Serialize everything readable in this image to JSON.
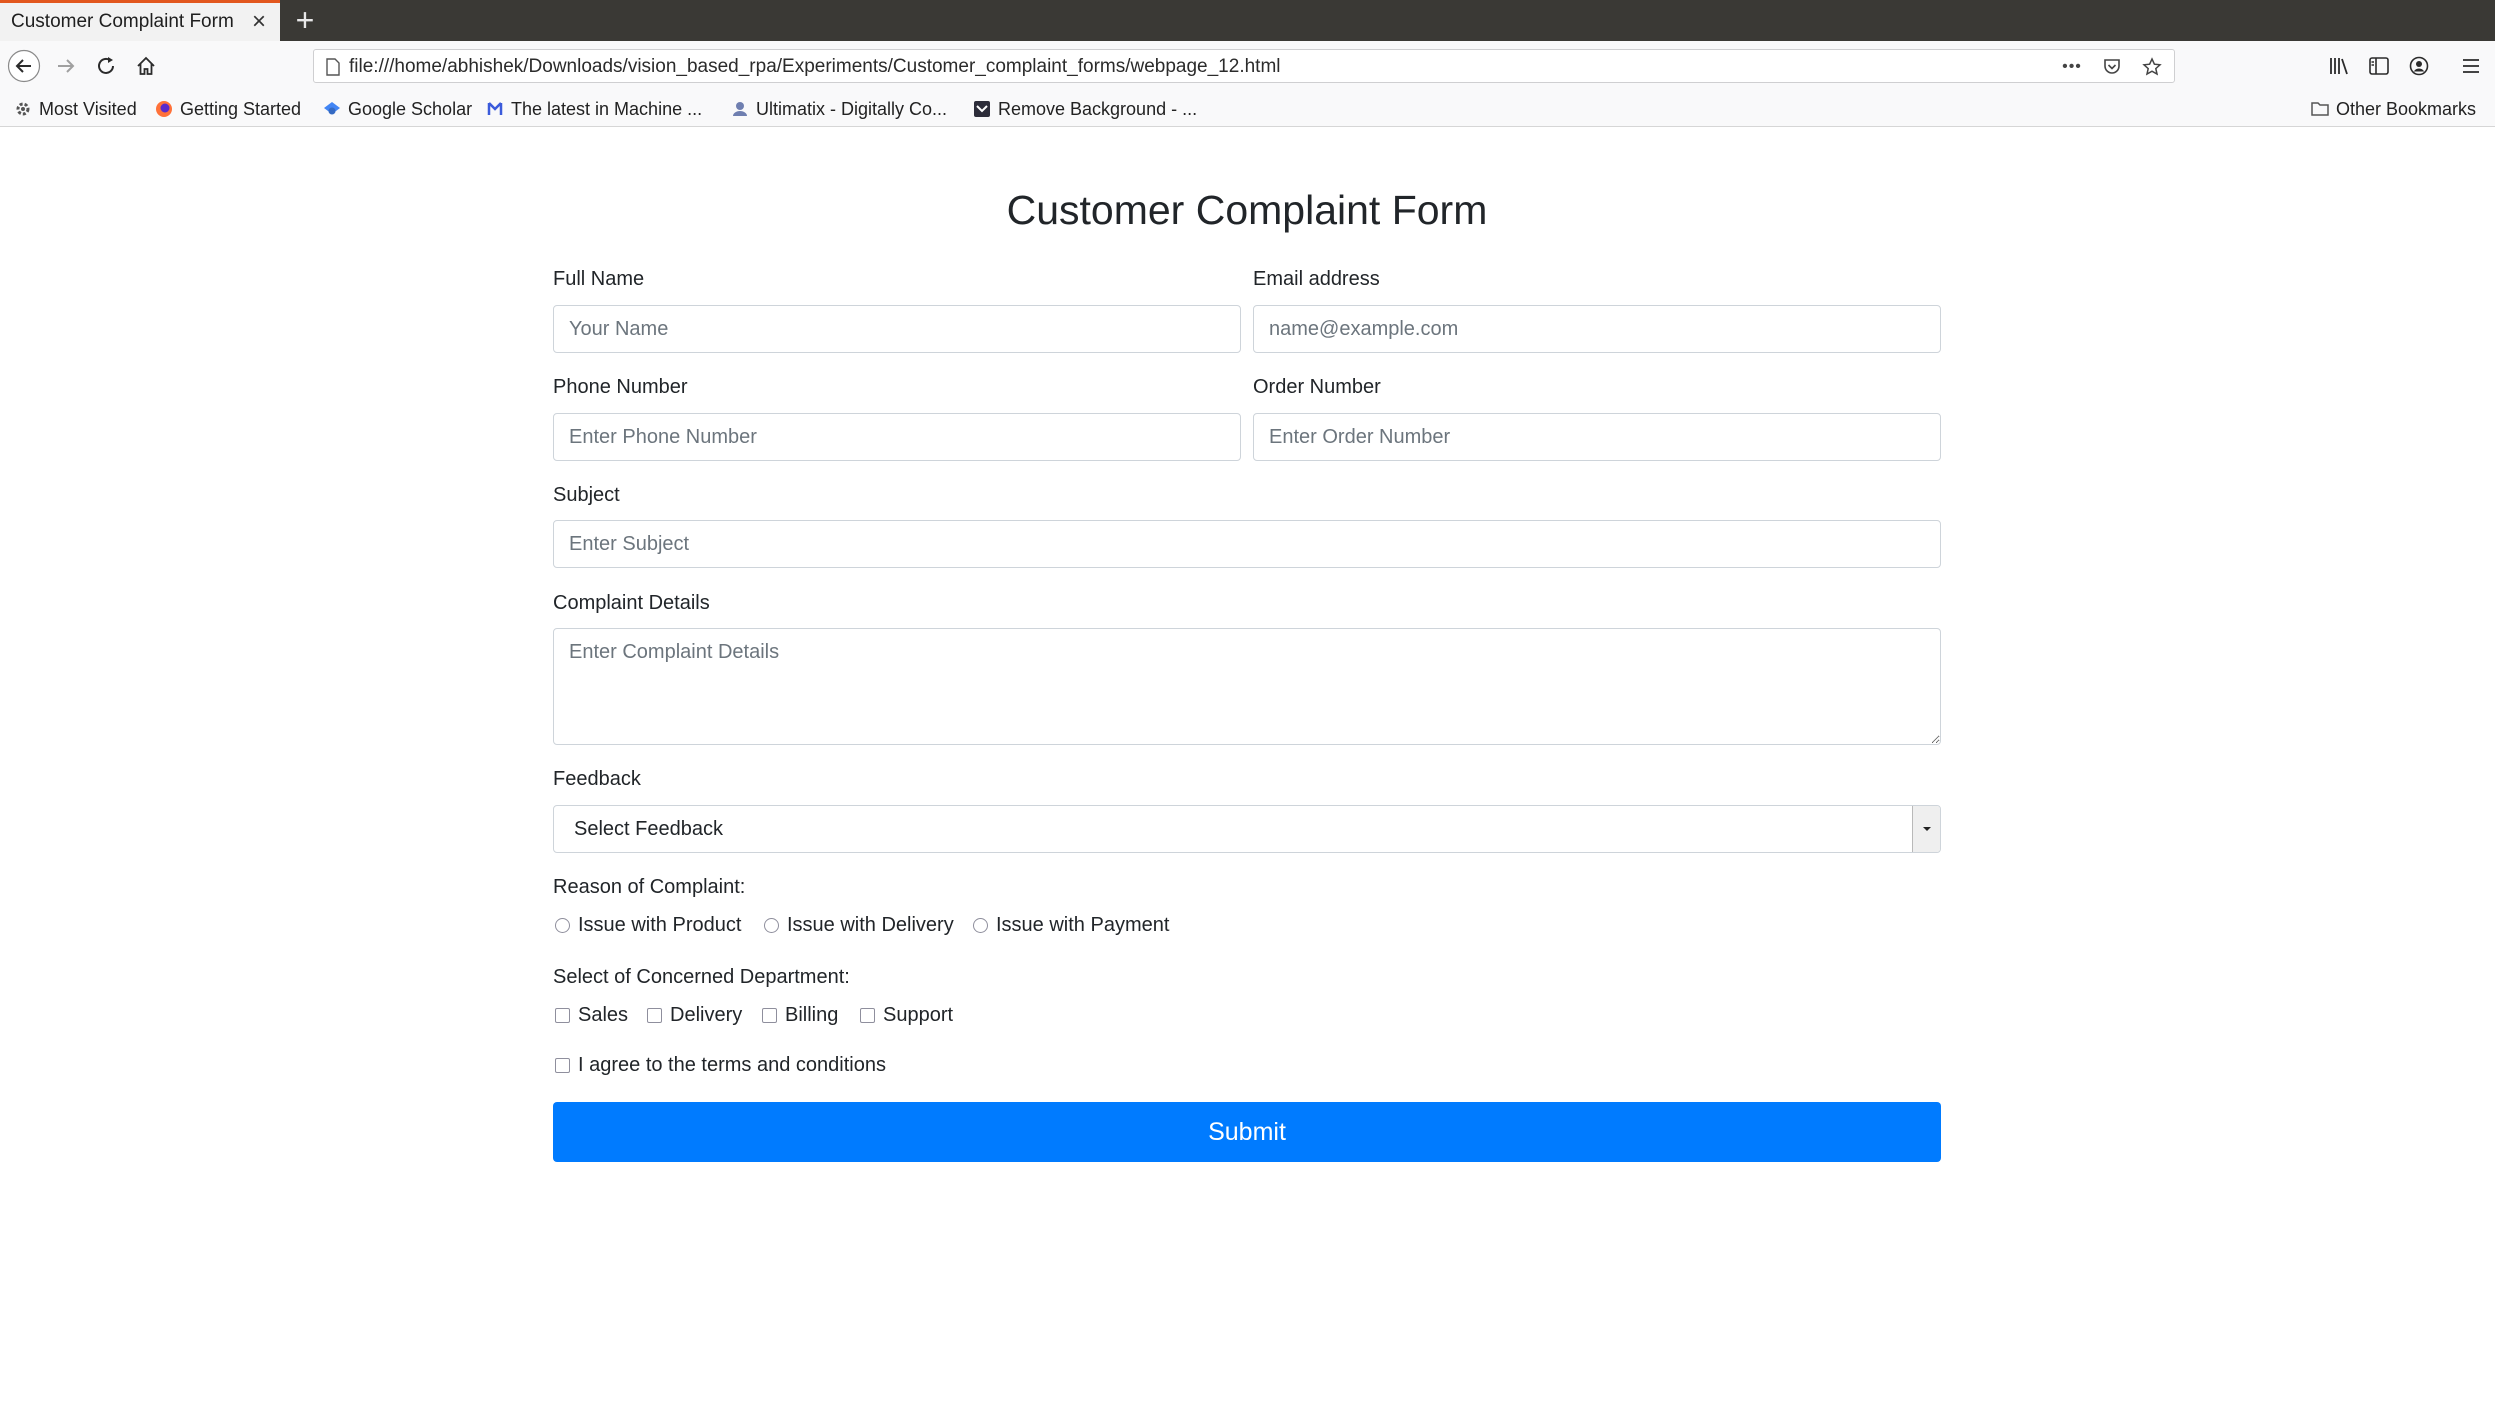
{
  "browser": {
    "tab_title": "Customer Complaint Form",
    "tab_close": "×",
    "new_tab": "+",
    "url": "file:///home/abhishek/Downloads/vision_based_rpa/Experiments/Customer_complaint_forms/webpage_12.html",
    "url_more": "•••",
    "bookmarks": [
      {
        "label": "Most Visited",
        "icon": "gear-icon"
      },
      {
        "label": "Getting Started",
        "icon": "firefox-icon"
      },
      {
        "label": "Google Scholar",
        "icon": "scholar-icon"
      },
      {
        "label": "The latest in Machine ...",
        "icon": "ml-icon"
      },
      {
        "label": "Ultimatix - Digitally Co...",
        "icon": "ultimatix-icon"
      },
      {
        "label": "Remove Background - ...",
        "icon": "removebg-icon"
      }
    ],
    "other_bookmarks": "Other Bookmarks"
  },
  "form": {
    "title": "Customer Complaint Form",
    "full_name": {
      "label": "Full Name",
      "placeholder": "Your Name"
    },
    "email": {
      "label": "Email address",
      "placeholder": "name@example.com"
    },
    "phone": {
      "label": "Phone Number",
      "placeholder": "Enter Phone Number"
    },
    "order": {
      "label": "Order Number",
      "placeholder": "Enter Order Number"
    },
    "subject": {
      "label": "Subject",
      "placeholder": "Enter Subject"
    },
    "details": {
      "label": "Complaint Details",
      "placeholder": "Enter Complaint Details"
    },
    "feedback": {
      "label": "Feedback",
      "selected": "Select Feedback"
    },
    "reason": {
      "label": "Reason of Complaint:",
      "options": [
        "Issue with Product",
        "Issue with Delivery",
        "Issue with Payment"
      ]
    },
    "department": {
      "label": "Select of Concerned Department:",
      "options": [
        "Sales",
        "Delivery",
        "Billing",
        "Support"
      ]
    },
    "terms": "I agree to the terms and conditions",
    "submit": "Submit"
  },
  "colors": {
    "primary": "#007bff",
    "tab_accent": "#e2571e",
    "tabbar_bg": "#3a3935"
  }
}
